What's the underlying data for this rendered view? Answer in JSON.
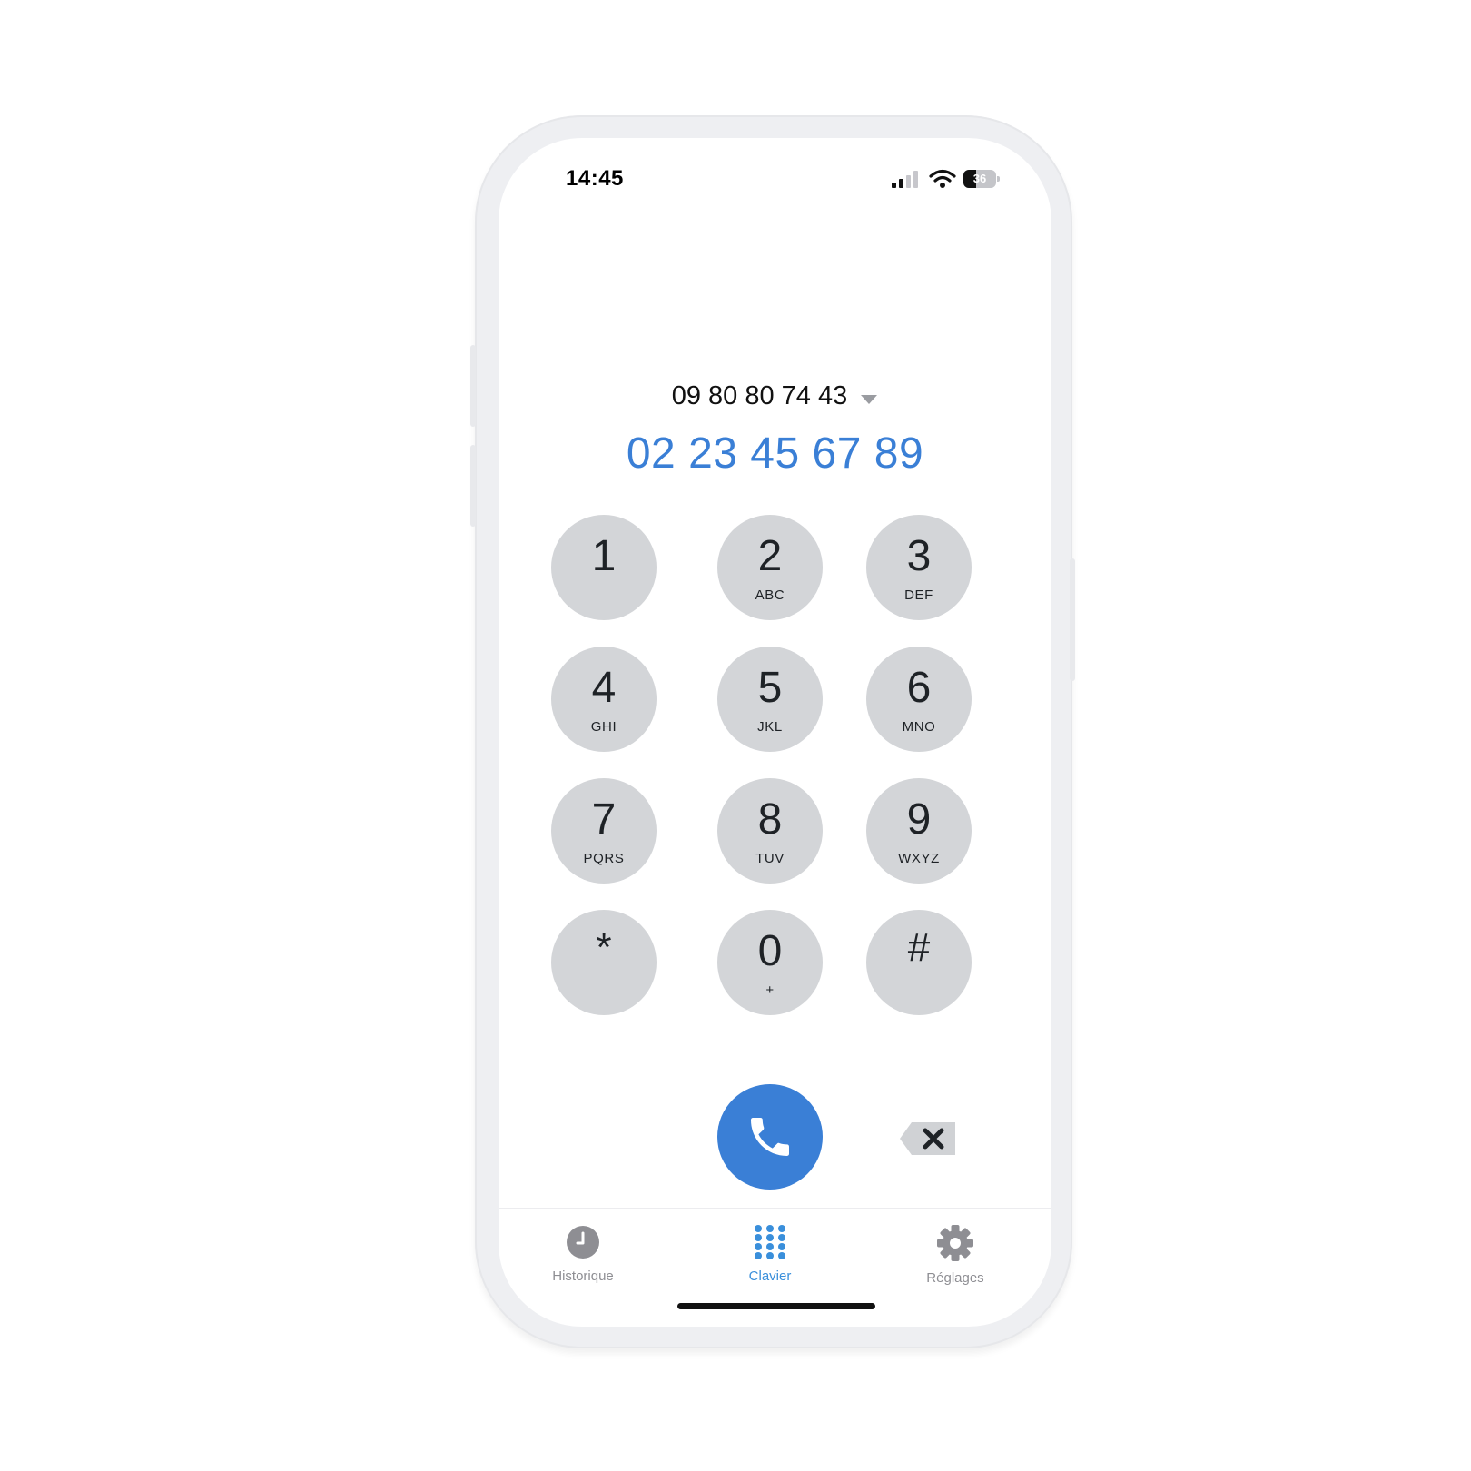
{
  "status_bar": {
    "time": "14:45",
    "battery": "36"
  },
  "caller_id": {
    "number": "09 80 80 74 43"
  },
  "dialer": {
    "number": "02 23 45 67 89"
  },
  "keypad": [
    {
      "digit": "1",
      "letters": ""
    },
    {
      "digit": "2",
      "letters": "ABC"
    },
    {
      "digit": "3",
      "letters": "DEF"
    },
    {
      "digit": "4",
      "letters": "GHI"
    },
    {
      "digit": "5",
      "letters": "JKL"
    },
    {
      "digit": "6",
      "letters": "MNO"
    },
    {
      "digit": "7",
      "letters": "PQRS"
    },
    {
      "digit": "8",
      "letters": "TUV"
    },
    {
      "digit": "9",
      "letters": "WXYZ"
    },
    {
      "digit": "*",
      "letters": ""
    },
    {
      "digit": "0",
      "letters": "+"
    },
    {
      "digit": "#",
      "letters": ""
    }
  ],
  "tabs": [
    {
      "label": "Historique",
      "icon": "clock-icon",
      "active": false
    },
    {
      "label": "Clavier",
      "icon": "keypad-icon",
      "active": true
    },
    {
      "label": "Réglages",
      "icon": "gear-icon",
      "active": false
    }
  ],
  "colors": {
    "accent": "#3a7fd6",
    "key_background": "#d3d5d8",
    "tab_active": "#3a8fdb",
    "tab_inactive": "#8e8e93"
  }
}
